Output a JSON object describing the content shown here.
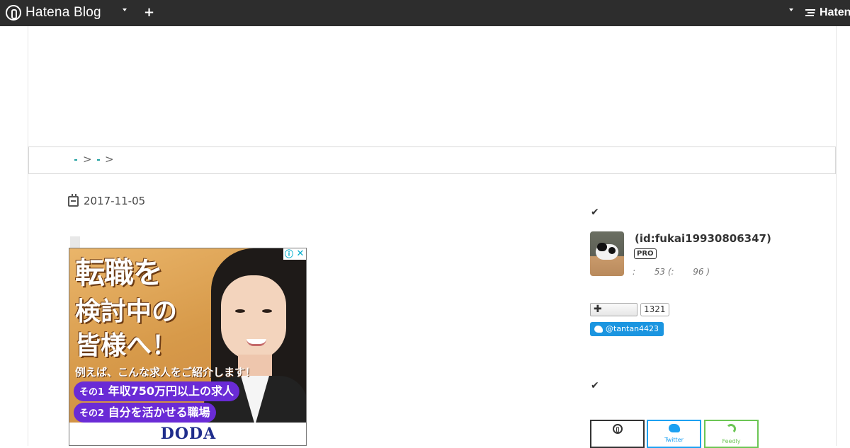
{
  "topbar": {
    "brand": "Hatena Blog",
    "right_brand": "Haten"
  },
  "breadcrumb": {
    "separator": ">"
  },
  "article": {
    "date": "2017-11-05"
  },
  "ad": {
    "headline_1": "転職を",
    "headline_2": "検討中の",
    "headline_3": "皆様へ！",
    "subline": "例えば、こんな求人をご紹介します！",
    "item_1_no": "その1",
    "item_1_text": "年収750万円以上の求人",
    "item_2_no": "その2",
    "item_2_text": "自分を活かせる職場",
    "brand": "DODA",
    "info_icon": "info-icon",
    "close_icon": "close-icon"
  },
  "sidebar": {
    "profile": {
      "user_id": "(id:fukai19930806347)",
      "badge": "PRO",
      "stats": ":       53 (:       96 )"
    },
    "follow": {
      "plus_symbol": "✚",
      "count": "1321",
      "twitter_handle": "@tantan4423"
    },
    "subscribe": {
      "twitter_label": "Twitter",
      "feedly_label": "Feedly"
    }
  },
  "colors": {
    "topbar": "#2d2d2d",
    "twitter": "#1b95e0",
    "feedly": "#6cc655",
    "ad_pill": "#6a2bd6",
    "doda": "#1f2d8c"
  }
}
